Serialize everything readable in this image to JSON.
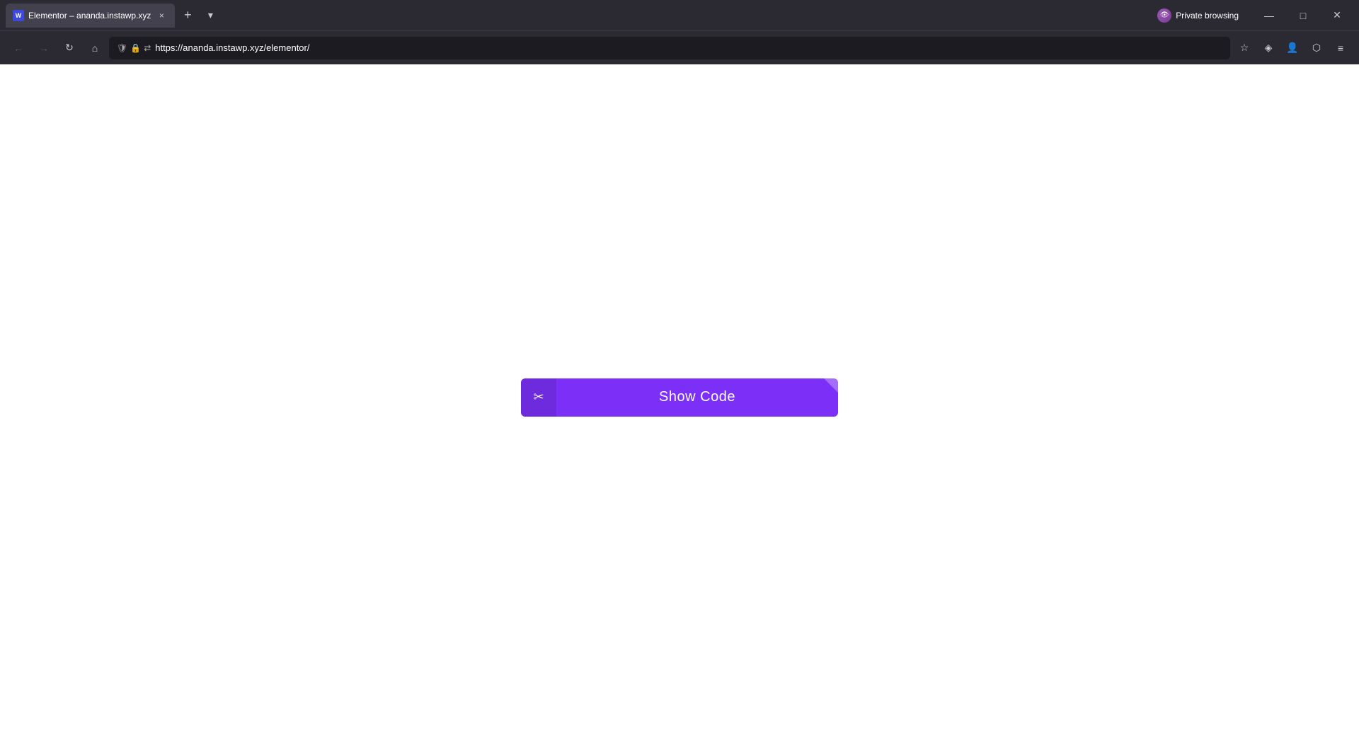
{
  "browser": {
    "tab": {
      "favicon_text": "W",
      "title": "Elementor – ananda.instawp.xyz",
      "close_label": "×"
    },
    "new_tab_label": "+",
    "tab_dropdown_label": "▾",
    "private_browsing": {
      "label": "Private browsing",
      "icon_text": "👁"
    },
    "window_controls": {
      "minimize": "—",
      "maximize": "□",
      "close": "✕"
    },
    "nav": {
      "back_icon": "←",
      "forward_icon": "→",
      "refresh_icon": "↻",
      "home_icon": "⌂",
      "security_shield": "🛡",
      "security_lock": "🔒",
      "tracking_icon": "⇄",
      "url": "https://ananda.instawp.xyz/elementor/",
      "star_icon": "☆",
      "pocket_icon": "◈",
      "profile_icon": "👤",
      "extensions_icon": "⬡",
      "menu_icon": "≡"
    }
  },
  "page": {
    "show_code_button": {
      "label": "Show Code",
      "icon": "✂"
    }
  }
}
